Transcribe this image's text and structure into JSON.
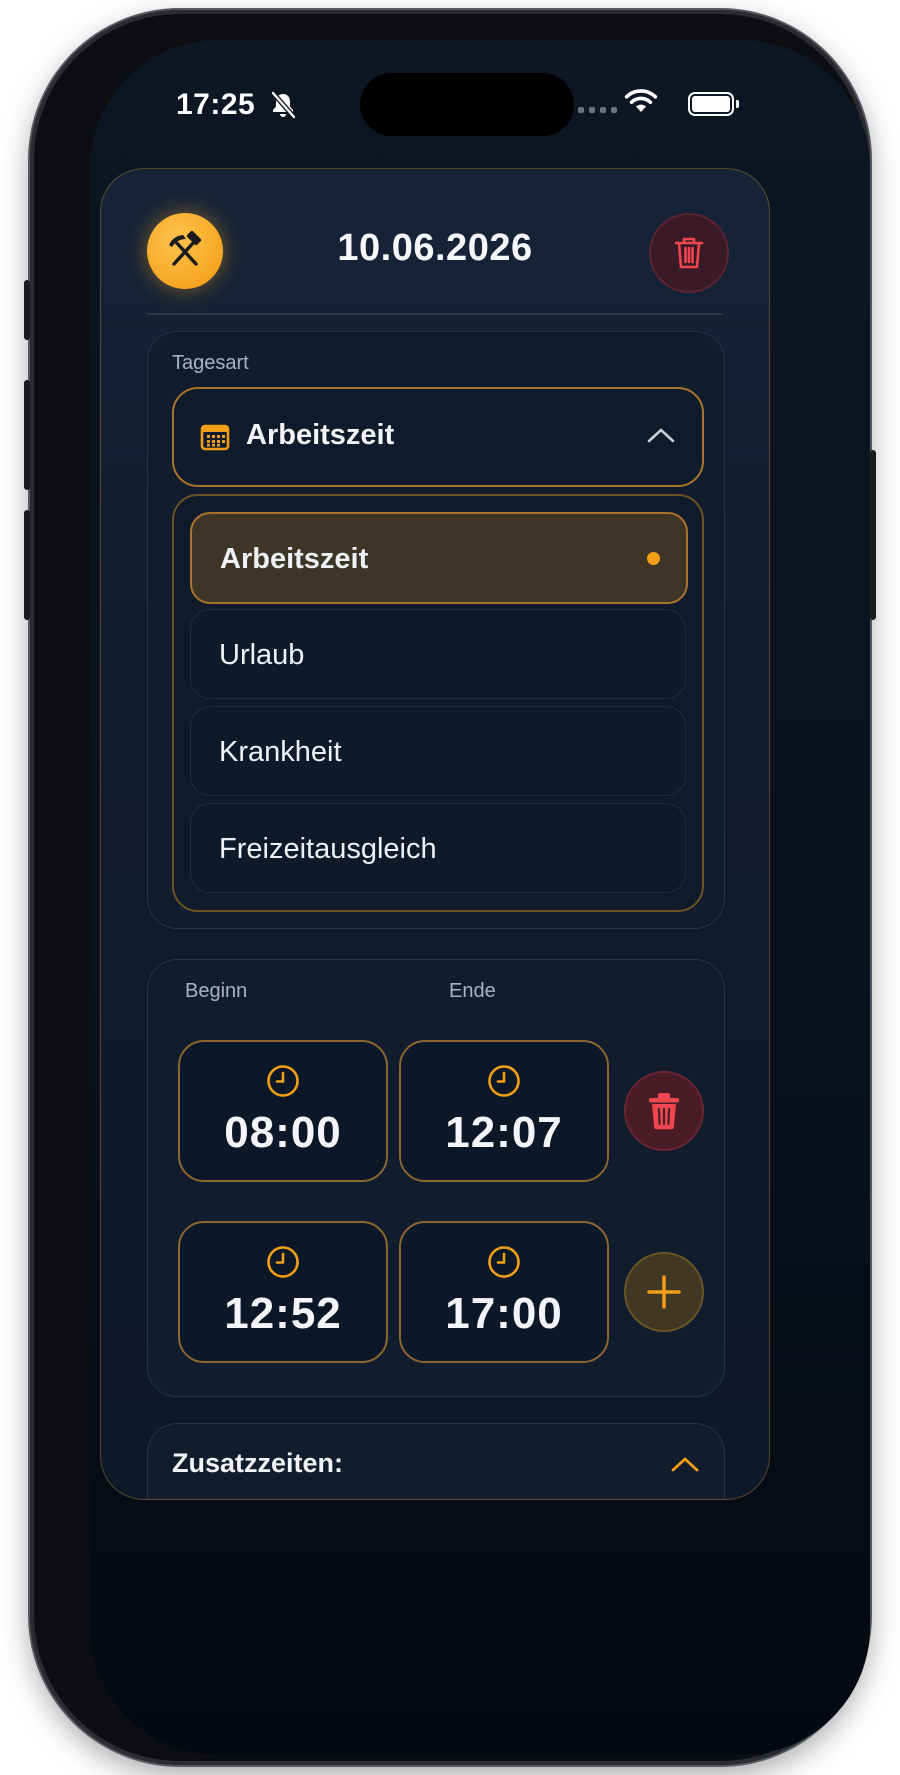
{
  "status_bar": {
    "time": "17:25"
  },
  "header": {
    "date": "10.06.2026"
  },
  "day_type": {
    "label": "Tagesart",
    "selected": "Arbeitszeit",
    "options": [
      {
        "label": "Arbeitszeit",
        "selected": true
      },
      {
        "label": "Urlaub",
        "selected": false
      },
      {
        "label": "Krankheit",
        "selected": false
      },
      {
        "label": "Freizeitausgleich",
        "selected": false
      }
    ]
  },
  "times": {
    "start_label": "Beginn",
    "end_label": "Ende",
    "rows": [
      {
        "start": "08:00",
        "end": "12:07"
      },
      {
        "start": "12:52",
        "end": "17:00"
      }
    ]
  },
  "extra": {
    "label": "Zusatzzeiten:"
  },
  "colors": {
    "accent": "#f29f17",
    "danger": "#f0464f",
    "background": "#0d1623",
    "card": "#111c2d"
  },
  "icons": {
    "header_left": "hammer-pick-icon",
    "header_right": "trash-icon",
    "select": "calendar-icon",
    "select_toggle": "chevron-up-icon",
    "time_box": "clock-icon",
    "row_delete": "trash-icon",
    "row_add": "plus-icon"
  }
}
